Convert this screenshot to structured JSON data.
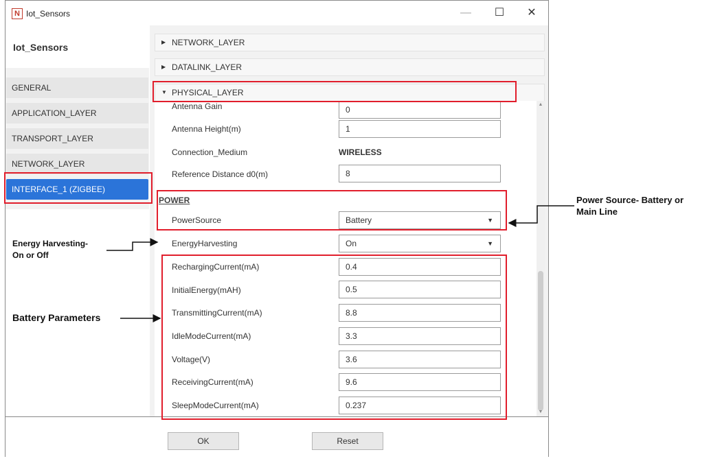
{
  "window": {
    "title": "Iot_Sensors",
    "controls": {
      "minimize": "—",
      "maximize": "☐",
      "close": "✕"
    }
  },
  "sidebar": {
    "device_name": "Iot_Sensors",
    "items": [
      {
        "label": "GENERAL"
      },
      {
        "label": "APPLICATION_LAYER"
      },
      {
        "label": "TRANSPORT_LAYER"
      },
      {
        "label": "NETWORK_LAYER"
      },
      {
        "label": "INTERFACE_1 (ZIGBEE)",
        "active": true
      }
    ]
  },
  "accordions": [
    {
      "label": "NETWORK_LAYER",
      "expanded": false
    },
    {
      "label": "DATALINK_LAYER",
      "expanded": false
    },
    {
      "label": "PHYSICAL_LAYER",
      "expanded": true
    }
  ],
  "physical": {
    "antenna_gain": {
      "label": "Antenna Gain",
      "value": "0"
    },
    "antenna_height": {
      "label": "Antenna Height(m)",
      "value": "1"
    },
    "connection_medium": {
      "label": "Connection_Medium",
      "value": "WIRELESS"
    },
    "reference_distance": {
      "label": "Reference Distance d0(m)",
      "value": "8"
    }
  },
  "power": {
    "heading": "POWER",
    "power_source": {
      "label": "PowerSource",
      "value": "Battery"
    },
    "energy_harvesting": {
      "label": "EnergyHarvesting",
      "value": "On"
    },
    "battery": [
      {
        "label": "RechargingCurrent(mA)",
        "value": "0.4"
      },
      {
        "label": "InitialEnergy(mAH)",
        "value": "0.5"
      },
      {
        "label": "TransmittingCurrent(mA)",
        "value": "8.8"
      },
      {
        "label": "IdleModeCurrent(mA)",
        "value": "3.3"
      },
      {
        "label": "Voltage(V)",
        "value": "3.6"
      },
      {
        "label": "ReceivingCurrent(mA)",
        "value": "9.6"
      },
      {
        "label": "SleepModeCurrent(mA)",
        "value": "0.237"
      }
    ]
  },
  "footer": {
    "ok_label": "OK",
    "reset_label": "Reset"
  },
  "annotations": {
    "power_source_line1": "Power Source- Battery or",
    "power_source_line2": "Main Line",
    "energy_line1": "Energy Harvesting-",
    "energy_line2": "On or Off",
    "battery_params": "Battery Parameters"
  },
  "colors": {
    "highlight": "#e11d2b",
    "active_nav": "#2b74d9"
  }
}
